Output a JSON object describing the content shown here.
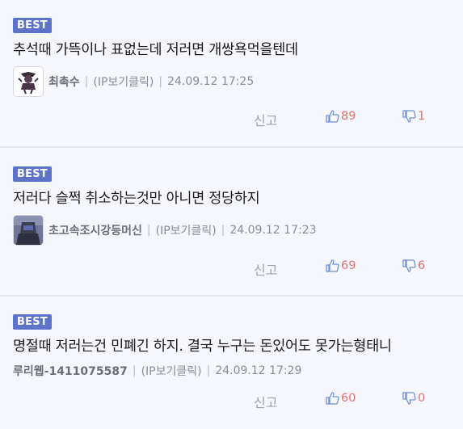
{
  "comments": [
    {
      "badge": "BEST",
      "text": "추석때 가뜩이나 표없는데 저러면 개쌍욕먹을텐데",
      "nickname": "최촉수",
      "ip_label": "(IP보기클릭)",
      "date": "24.09.12 17:25",
      "report": "신고",
      "likes": "89",
      "dislikes": "1"
    },
    {
      "badge": "BEST",
      "text": "저러다 슬쩍 취소하는것만 아니면 정당하지",
      "nickname": "초고속조시강등머신",
      "ip_label": "(IP보기클릭)",
      "date": "24.09.12 17:23",
      "report": "신고",
      "likes": "69",
      "dislikes": "6"
    },
    {
      "badge": "BEST",
      "text": "명절때 저러는건 민폐긴 하지. 결국 누구는 돈있어도 못가는형태니",
      "nickname": "루리웹-1411075587",
      "ip_label": "(IP보기클릭)",
      "date": "24.09.12 17:29",
      "report": "신고",
      "likes": "60",
      "dislikes": "0"
    }
  ],
  "colors": {
    "badge": "#5d73c9",
    "vote": "#e07070",
    "background": "#f6f7fc"
  }
}
